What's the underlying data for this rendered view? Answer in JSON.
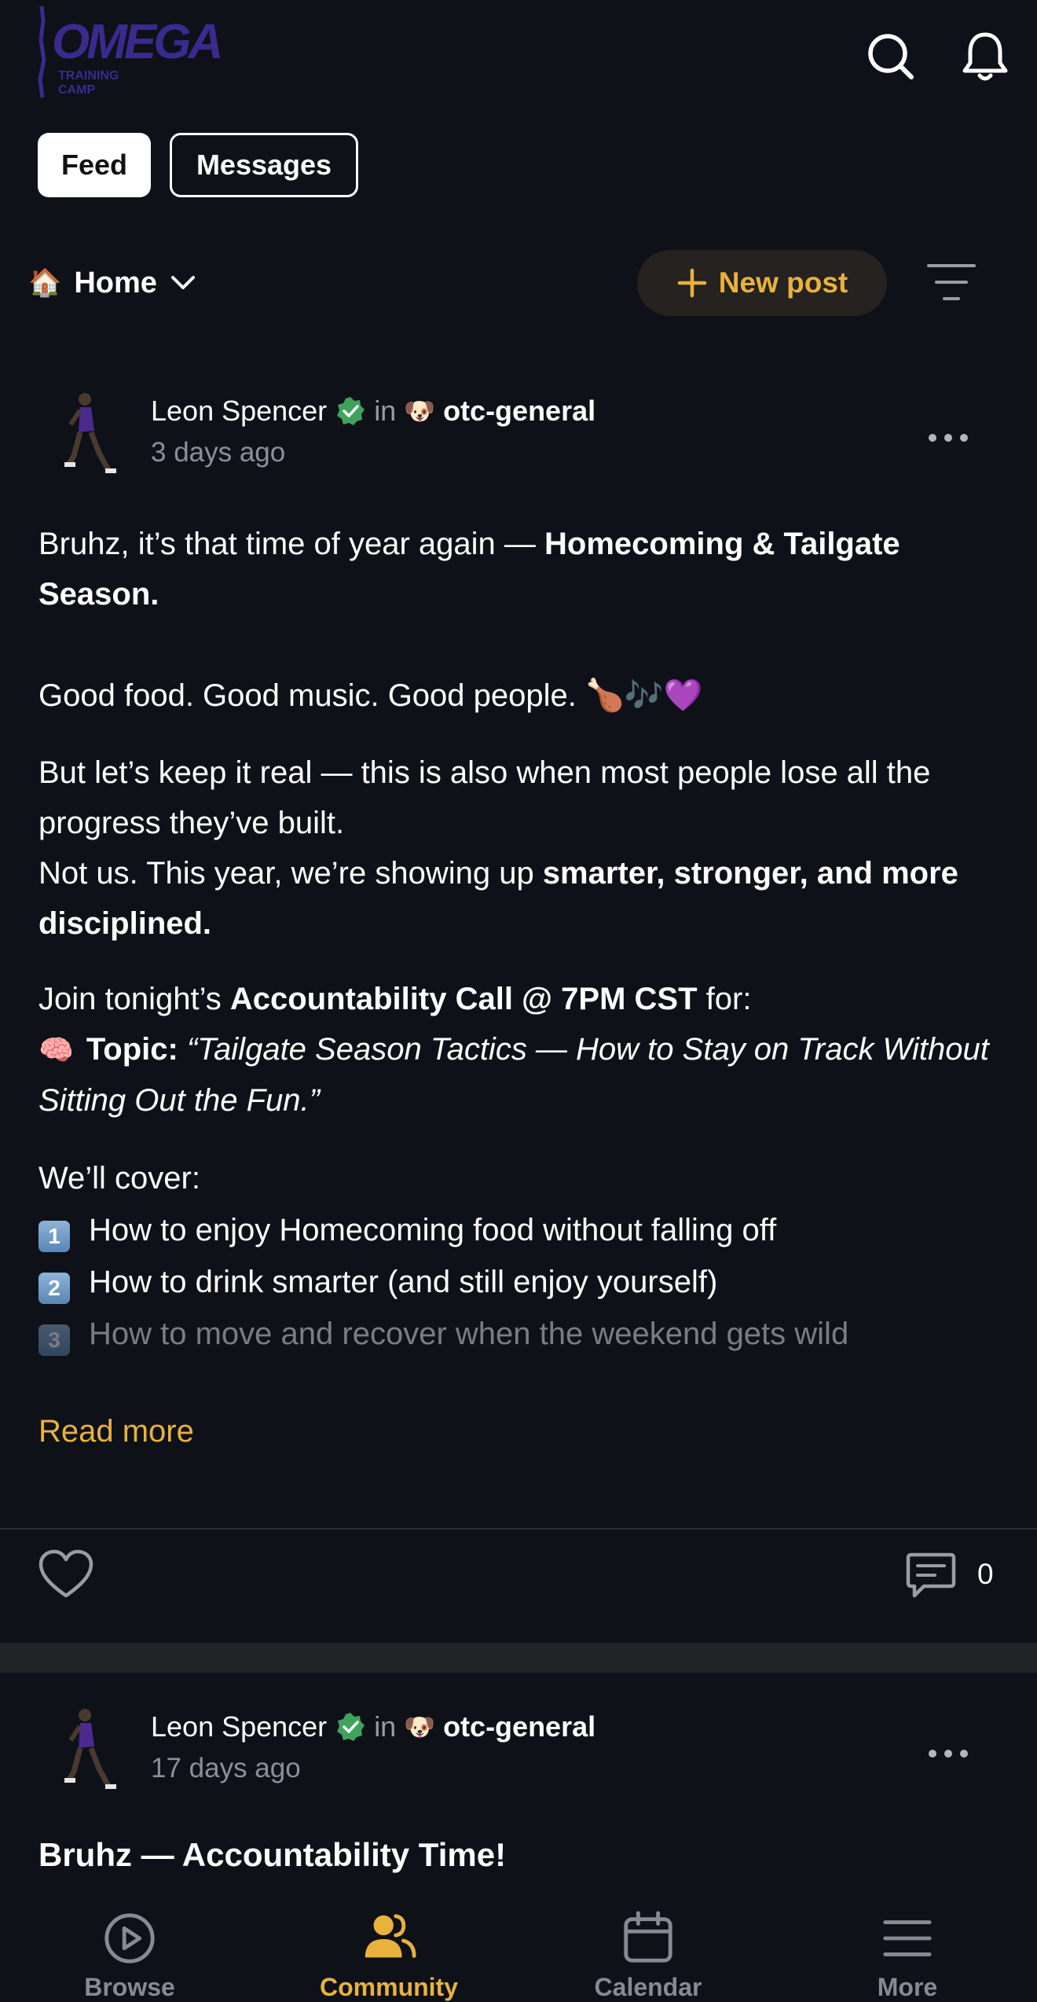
{
  "header": {
    "logo_text": "OMEGA",
    "logo_subtext": "TRAINING CAMP"
  },
  "tabs": [
    {
      "label": "Feed",
      "active": true
    },
    {
      "label": "Messages",
      "active": false
    }
  ],
  "toolbar": {
    "space_emoji": "🏠",
    "space_label": "Home",
    "new_post_label": "New post"
  },
  "posts": [
    {
      "author": "Leon Spencer",
      "in_word": "in",
      "channel_emoji": "🐶",
      "channel": "otc-general",
      "time": "3 days ago",
      "p1_a": "Bruhz, it’s that time of year again — ",
      "p1_b": "Homecoming & Tailgate Season.",
      "p2": "Good food. Good music. Good people. 🍗🎶💜",
      "p3_a": "But let’s keep it real — this is also when most people lose all the progress they’ve built.",
      "p3_b": "Not us. This year, we’re showing up ",
      "p3_c": "smarter, stronger, and more disciplined.",
      "p4_a": "Join tonight’s ",
      "p4_b": "Accountability Call @ 7PM CST",
      "p4_c": " for:",
      "p5_emoji": "🧠",
      "p5_b": "Topic:",
      "p5_i": "“Tailgate Season Tactics — How to Stay on Track Without Sitting Out the Fun.”",
      "p6": "We’ll cover:",
      "list": [
        {
          "num": "1",
          "text": "How to enjoy Homecoming food without falling off"
        },
        {
          "num": "2",
          "text": "How to drink smarter (and still enjoy yourself)"
        },
        {
          "num": "3",
          "text": "How to move and recover when the weekend gets wild"
        }
      ],
      "read_more": "Read more",
      "comments": "0"
    },
    {
      "author": "Leon Spencer",
      "in_word": "in",
      "channel_emoji": "🐶",
      "channel": "otc-general",
      "time": "17 days ago",
      "title": "Bruhz — Accountability Time!"
    }
  ],
  "bottom_nav": [
    {
      "label": "Browse",
      "icon": "play-circle-icon",
      "active": false
    },
    {
      "label": "Community",
      "icon": "community-icon",
      "active": true
    },
    {
      "label": "Calendar",
      "icon": "calendar-icon",
      "active": false
    },
    {
      "label": "More",
      "icon": "menu-icon",
      "active": false
    }
  ],
  "colors": {
    "background": "#0f1118",
    "accent": "#e8b23d",
    "verified": "#3fa35e",
    "logo": "#3b2a8e"
  }
}
